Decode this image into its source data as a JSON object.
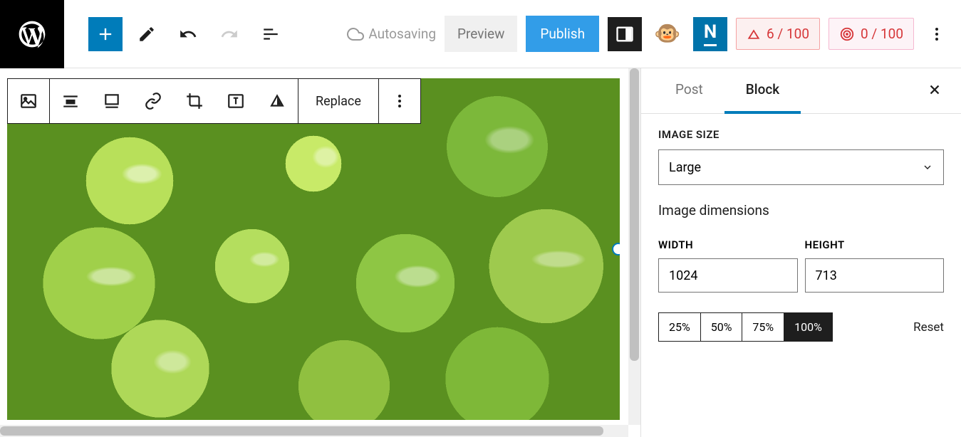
{
  "topbar": {
    "autosaving": "Autosaving",
    "preview": "Preview",
    "publish": "Publish",
    "n_label": "N",
    "score1": "6 / 100",
    "score2": "0 / 100"
  },
  "block_toolbar": {
    "replace": "Replace"
  },
  "sidebar": {
    "tabs": {
      "post": "Post",
      "block": "Block"
    },
    "image_size_label": "IMAGE SIZE",
    "image_size_value": "Large",
    "dimensions_heading": "Image dimensions",
    "width_label": "WIDTH",
    "width_value": "1024",
    "height_label": "HEIGHT",
    "height_value": "713",
    "percents": [
      "25%",
      "50%",
      "75%",
      "100%"
    ],
    "percent_active": 3,
    "reset": "Reset"
  }
}
